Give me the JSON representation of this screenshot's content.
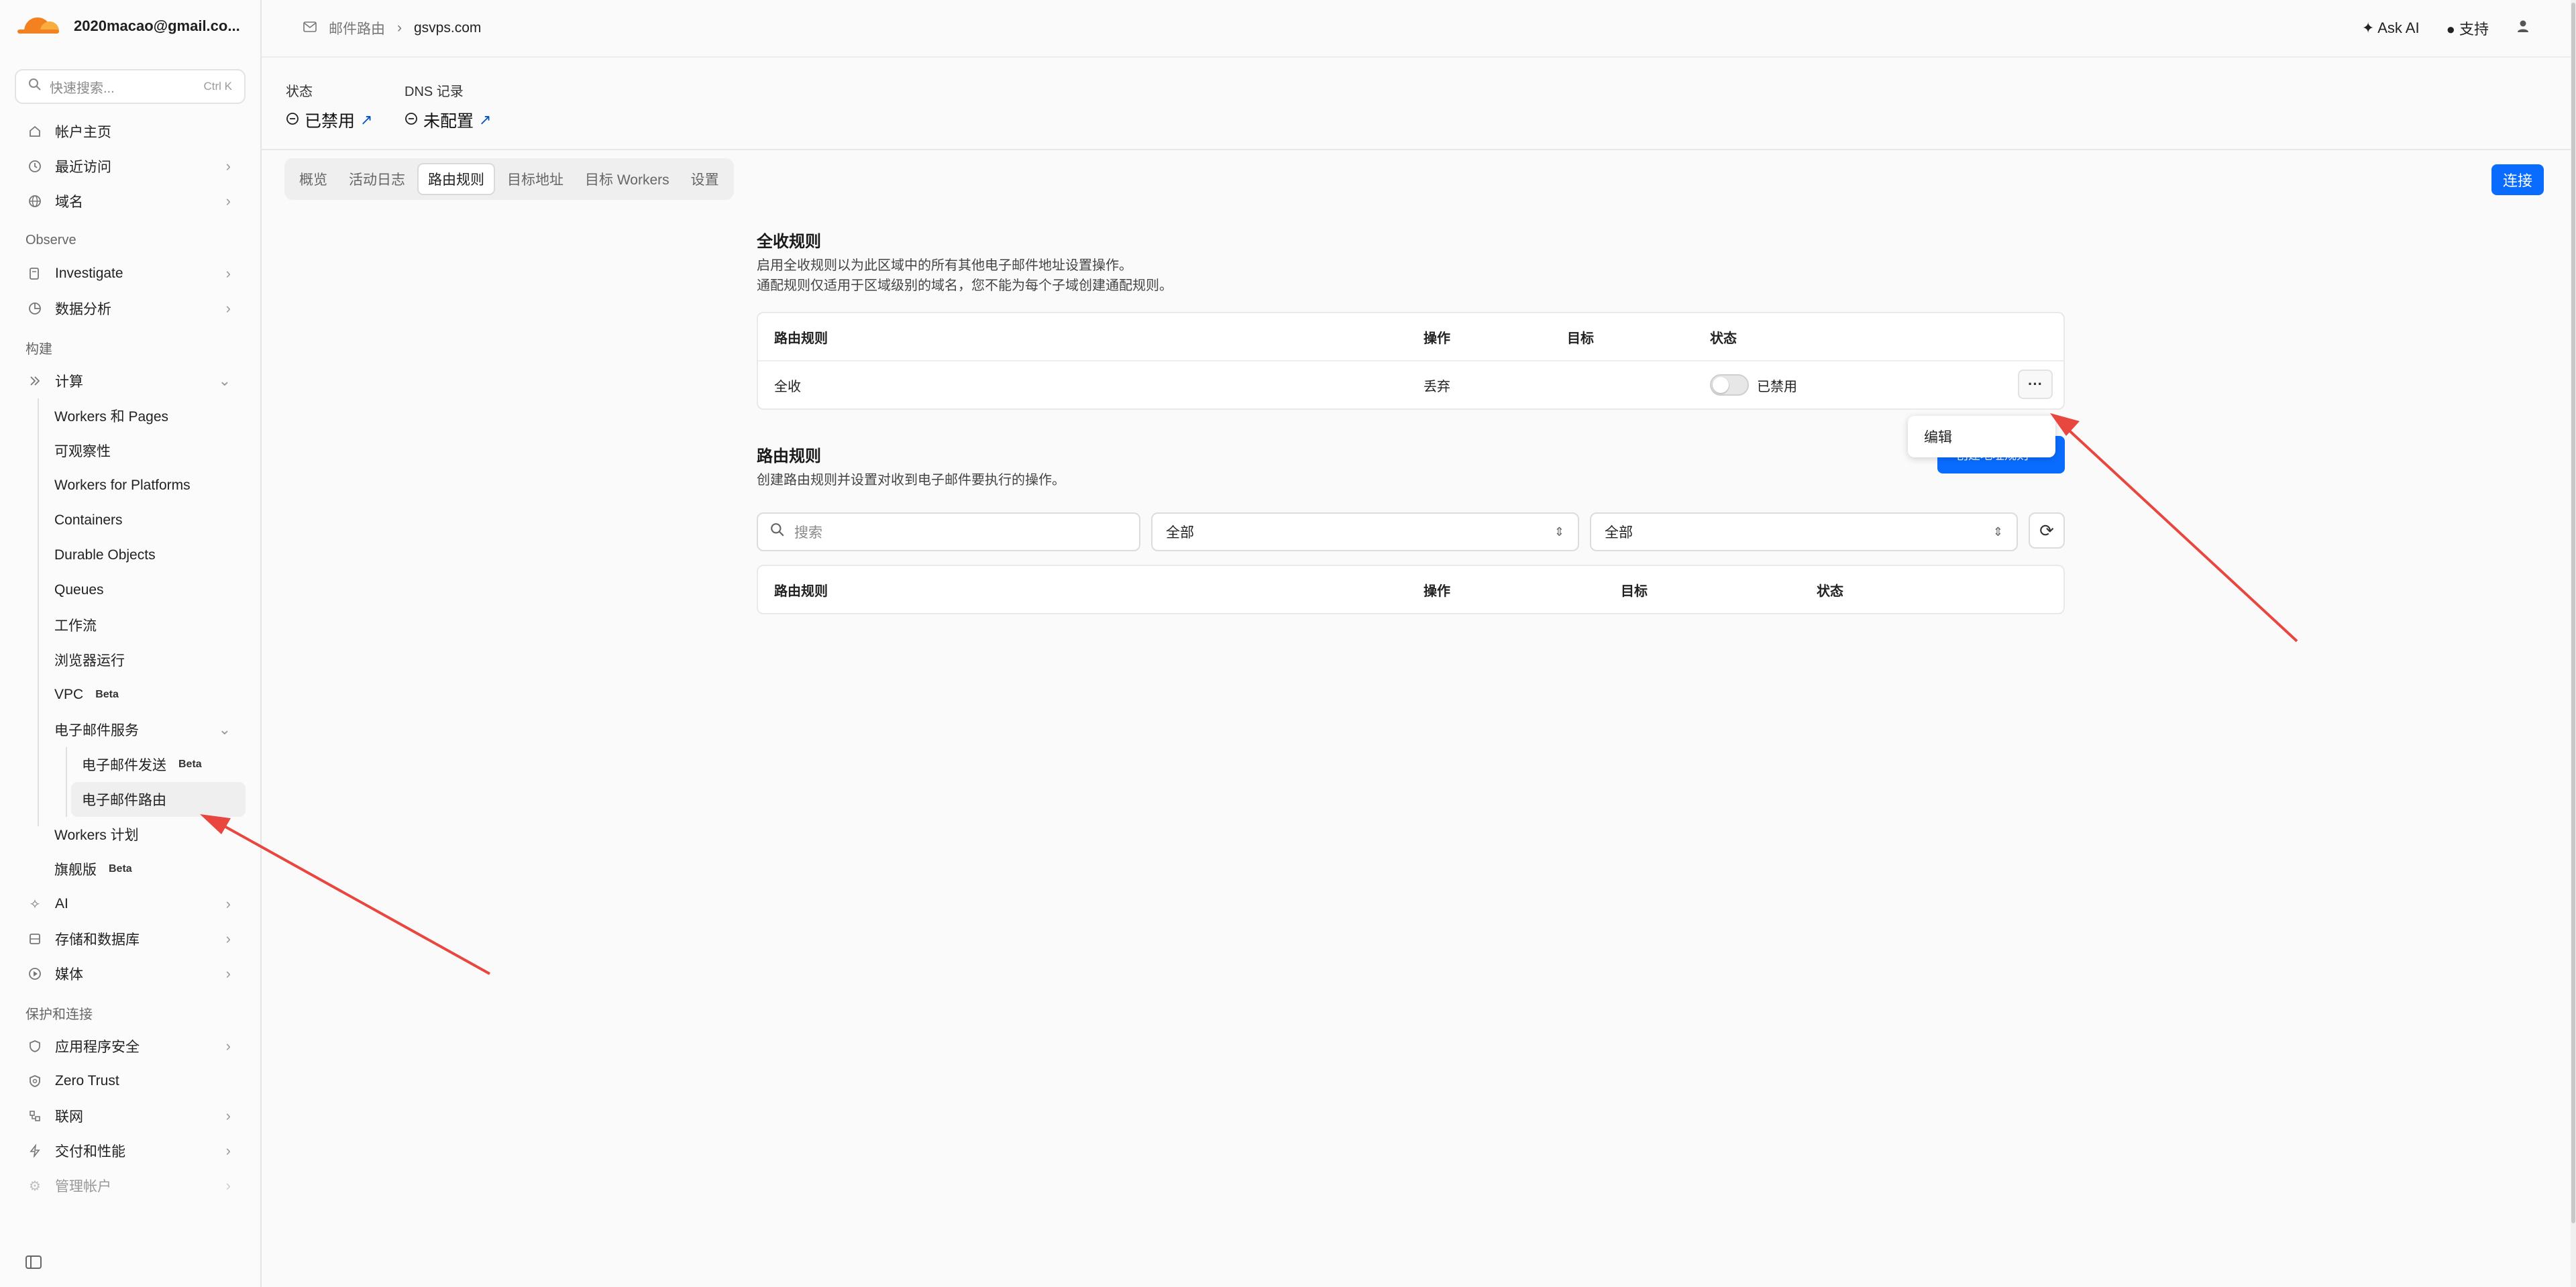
{
  "account": {
    "email": "2020macao@gmail.co..."
  },
  "search": {
    "placeholder": "快速搜索...",
    "shortcut": "Ctrl K"
  },
  "nav": {
    "account_home": "帐户主页",
    "recent": "最近访问",
    "domains": "域名",
    "section_observe": "Observe",
    "investigate": "Investigate",
    "analytics": "数据分析",
    "section_build": "构建",
    "compute": "计算",
    "workers_pages": "Workers 和 Pages",
    "observability": "可观察性",
    "workers_platforms": "Workers for Platforms",
    "containers": "Containers",
    "durable_objects": "Durable Objects",
    "queues": "Queues",
    "workflows": "工作流",
    "browser_run": "浏览器运行",
    "vpc": "VPC",
    "beta": "Beta",
    "email_service": "电子邮件服务",
    "email_sending": "电子邮件发送",
    "email_routing": "电子邮件路由",
    "workers_plans": "Workers 计划",
    "flagship": "旗舰版",
    "ai": "AI",
    "storage_db": "存储和数据库",
    "media": "媒体",
    "section_protect": "保护和连接",
    "app_security": "应用程序安全",
    "zero_trust": "Zero Trust",
    "network": "联网",
    "delivery_perf": "交付和性能",
    "manage_account": "管理帐户"
  },
  "topbar": {
    "crumb_parent": "邮件路由",
    "crumb_current": "gsvps.com",
    "ask_ai": "Ask AI",
    "support": "支持"
  },
  "status": {
    "state_label": "状态",
    "state_value": "已禁用",
    "dns_label": "DNS 记录",
    "dns_value": "未配置"
  },
  "tabs": [
    "概览",
    "活动日志",
    "路由规则",
    "目标地址",
    "目标 Workers",
    "设置"
  ],
  "active_tab": "路由规则",
  "connect_label": "连接",
  "catchall": {
    "title": "全收规则",
    "desc1": "启用全收规则以为此区域中的所有其他电子邮件地址设置操作。",
    "desc2": "通配规则仅适用于区域级别的域名，您不能为每个子域创建通配规则。",
    "headers": [
      "路由规则",
      "操作",
      "目标",
      "状态"
    ],
    "row": {
      "rule": "全收",
      "action": "丢弃",
      "target": "",
      "status": "已禁用"
    },
    "menu_item": "编辑"
  },
  "routing": {
    "title": "路由规则",
    "desc": "创建路由规则并设置对收到电子邮件要执行的操作。",
    "create_button": "创建地址规则",
    "search_placeholder": "搜索",
    "filter1": "全部",
    "filter2": "全部",
    "headers": [
      "路由规则",
      "操作",
      "目标",
      "状态"
    ]
  },
  "colors": {
    "accent": "#0a6cff",
    "cloudflare_orange": "#f48120",
    "annotation_arrow": "#e8463f"
  }
}
